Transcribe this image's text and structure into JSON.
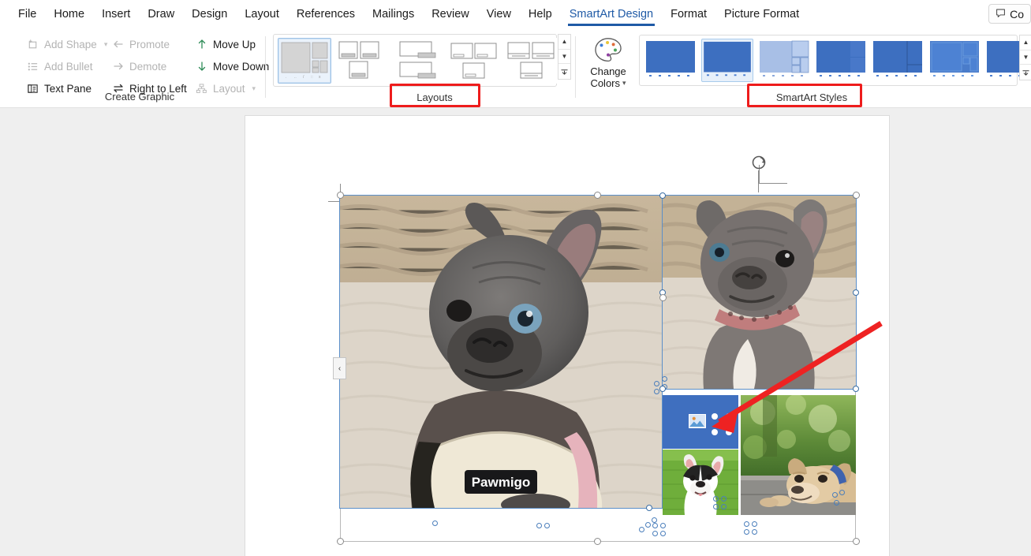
{
  "window": {
    "app": "Microsoft Word",
    "comments_label": "Co",
    "comments_full": "Comments",
    "comments_icon": "comment-icon"
  },
  "menubar": {
    "tabs": [
      {
        "label": "File",
        "active": false
      },
      {
        "label": "Home",
        "active": false
      },
      {
        "label": "Insert",
        "active": false
      },
      {
        "label": "Draw",
        "active": false
      },
      {
        "label": "Design",
        "active": false
      },
      {
        "label": "Layout",
        "active": false
      },
      {
        "label": "References",
        "active": false
      },
      {
        "label": "Mailings",
        "active": false
      },
      {
        "label": "Review",
        "active": false
      },
      {
        "label": "View",
        "active": false
      },
      {
        "label": "Help",
        "active": false
      },
      {
        "label": "SmartArt Design",
        "active": true
      },
      {
        "label": "Format",
        "active": false
      },
      {
        "label": "Picture Format",
        "active": false
      }
    ],
    "active_tab": "SmartArt Design",
    "accent_color": "#1f5aa6"
  },
  "ribbon": {
    "groups": [
      {
        "name": "create-graphic",
        "label": "Create Graphic"
      },
      {
        "name": "layouts",
        "label": "Layouts"
      },
      {
        "name": "smartart-styles",
        "label": "SmartArt Styles"
      }
    ],
    "create_graphic": {
      "label": "Create Graphic",
      "commands": [
        {
          "label": "Add Shape",
          "icon": "add-shape-icon",
          "disabled": true,
          "caret": true
        },
        {
          "label": "Add Bullet",
          "icon": "add-bullet-icon",
          "disabled": true,
          "caret": false
        },
        {
          "label": "Text Pane",
          "icon": "text-pane-icon",
          "disabled": false,
          "caret": false
        },
        {
          "label": "Promote",
          "icon": "arrow-left-icon",
          "disabled": true,
          "caret": false
        },
        {
          "label": "Demote",
          "icon": "arrow-right-icon",
          "disabled": true,
          "caret": false
        },
        {
          "label": "Right to Left",
          "icon": "swap-arrows-icon",
          "disabled": false,
          "caret": false
        },
        {
          "label": "Move Up",
          "icon": "arrow-up-icon",
          "disabled": false,
          "caret": false
        },
        {
          "label": "Move Down",
          "icon": "arrow-down-icon",
          "disabled": false,
          "caret": false
        },
        {
          "label": "Layout",
          "icon": "hierarchy-icon",
          "disabled": true,
          "caret": true
        }
      ]
    },
    "layouts": {
      "label": "Layouts",
      "annotated": true,
      "annotation_color": "#ee1c1c",
      "selected_index": 0,
      "thumbnails": [
        {
          "name": "layout-picture-grid",
          "selected": true
        },
        {
          "name": "layout-three-captioned",
          "selected": false
        },
        {
          "name": "layout-two-stacked-caption",
          "selected": false
        },
        {
          "name": "layout-three-overlap",
          "selected": false
        },
        {
          "name": "layout-three-lined",
          "selected": false
        }
      ],
      "scroll_buttons": [
        {
          "name": "scroll-up-button",
          "glyph": "▲"
        },
        {
          "name": "scroll-down-button",
          "glyph": "▼"
        },
        {
          "name": "more-layouts-button",
          "glyph": "▾"
        }
      ]
    },
    "change_colors": {
      "label_line1": "Change",
      "label_line2": "Colors",
      "icon": "color-palette-icon",
      "caret": "ˇ"
    },
    "smartart_styles": {
      "label": "SmartArt Styles",
      "annotated": true,
      "annotation_color": "#ee1c1c",
      "selected_index": 1,
      "thumbnails": [
        {
          "name": "style-simple-fill",
          "selected": false
        },
        {
          "name": "style-subtle-effect",
          "selected": true
        },
        {
          "name": "style-moderate-effect",
          "selected": false
        },
        {
          "name": "style-intense-effect",
          "selected": false
        },
        {
          "name": "style-polished",
          "selected": false
        },
        {
          "name": "style-inset",
          "selected": false
        },
        {
          "name": "style-cartoon",
          "selected": false
        }
      ],
      "scroll_buttons": [
        {
          "name": "scroll-up-button",
          "glyph": "▲"
        },
        {
          "name": "scroll-down-button",
          "glyph": "▼"
        },
        {
          "name": "more-styles-button",
          "glyph": "▾"
        }
      ]
    }
  },
  "document": {
    "page_name": "document-page",
    "smartart": {
      "name": "smartart-graphic",
      "selected": true,
      "rotation_handle": "rotate-icon",
      "text_pane_toggle": "‹",
      "shapes": [
        {
          "name": "picture-shape-main",
          "content": "grey french bulldog puppy wearing cream harness labelled Pawmigo",
          "brand_text": "Pawmigo",
          "filled": true
        },
        {
          "name": "picture-shape-top-right",
          "content": "grey french bulldog puppy with patterned collar",
          "filled": true
        },
        {
          "name": "picture-placeholder-shape",
          "content": "empty picture placeholder",
          "filled": false,
          "icon": "picture-placeholder-icon",
          "fill_color": "#3f6fbf"
        },
        {
          "name": "picture-shape-grass",
          "content": "black and white french bulldog on green grass",
          "filled": true
        },
        {
          "name": "picture-shape-pavement",
          "content": "tan french bulldog lying on pavement with blue collar",
          "filled": true
        }
      ]
    },
    "annotation_arrow": {
      "name": "red-pointer-arrow",
      "color": "#ee2222",
      "points_to": "picture-placeholder-shape"
    }
  }
}
